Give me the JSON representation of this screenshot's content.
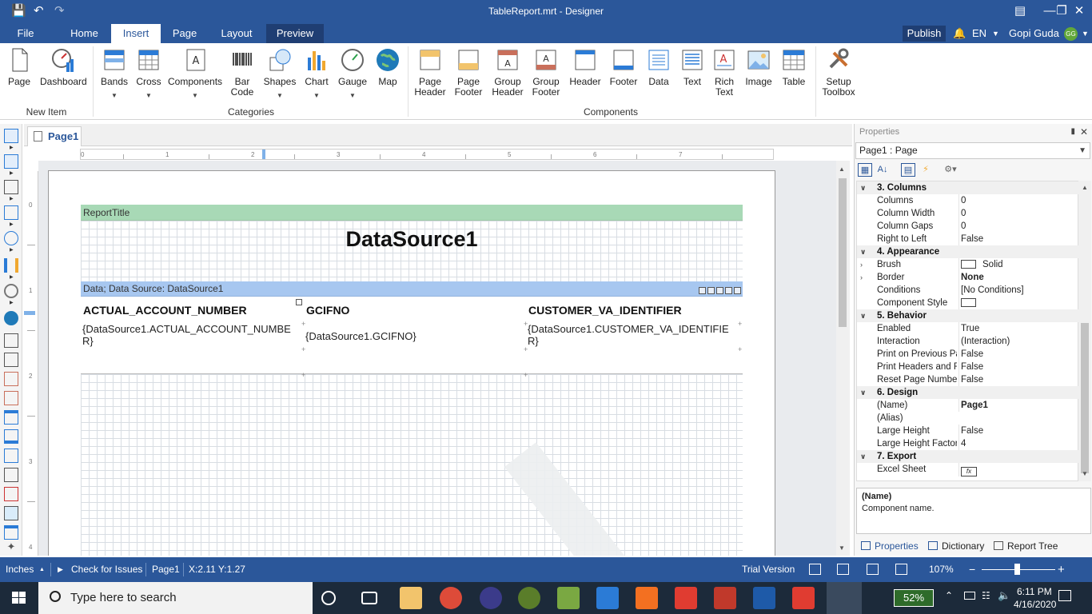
{
  "window": {
    "title": "TableReport.mrt - Designer"
  },
  "tabs": [
    {
      "label": "File"
    },
    {
      "label": "Home"
    },
    {
      "label": "Insert"
    },
    {
      "label": "Page"
    },
    {
      "label": "Layout"
    },
    {
      "label": "Preview"
    }
  ],
  "account": {
    "publish": "Publish",
    "language": "EN",
    "user": "Gopi Guda",
    "initials": "GG"
  },
  "ribbon": {
    "new_item": {
      "group": "New Item",
      "page": "Page",
      "dashboard": "Dashboard"
    },
    "categories": {
      "group": "Categories",
      "bands": "Bands",
      "cross": "Cross",
      "components": "Components",
      "barcode": "Bar Code",
      "shapes": "Shapes",
      "chart": "Chart",
      "gauge": "Gauge",
      "map": "Map"
    },
    "components": {
      "group": "Components",
      "page_header": "Page Header",
      "page_footer": "Page Footer",
      "group_header": "Group Header",
      "group_footer": "Group Footer",
      "header": "Header",
      "footer": "Footer",
      "data": "Data",
      "text": "Text",
      "rich_text": "Rich Text",
      "image": "Image",
      "table": "Table"
    },
    "setup_toolbox": "Setup Toolbox"
  },
  "document": {
    "tab": "Page1",
    "ruler_h": [
      "0",
      "1",
      "2",
      "3",
      "4",
      "5",
      "6",
      "7"
    ],
    "ruler_v": [
      "0",
      "1",
      "2",
      "3",
      "4"
    ],
    "report_title_band": "ReportTitle",
    "title_text": "DataSource1",
    "data_band": "Data; Data Source: DataSource1",
    "columns": [
      {
        "header": "ACTUAL_ACCOUNT_NUMBER",
        "expr": "{DataSource1.ACTUAL_ACCOUNT_NUMBER}"
      },
      {
        "header": "GCIFNO",
        "expr": "{DataSource1.GCIFNO}"
      },
      {
        "header": "CUSTOMER_VA_IDENTIFIER",
        "expr": "{DataSource1.CUSTOMER_VA_IDENTIFIER}"
      }
    ]
  },
  "properties": {
    "header": "Properties",
    "selected": "Page1 : Page",
    "rows": [
      {
        "cat": true,
        "name": "3. Columns"
      },
      {
        "name": "Columns",
        "value": "0"
      },
      {
        "name": "Column Width",
        "value": "0"
      },
      {
        "name": "Column Gaps",
        "value": "0"
      },
      {
        "name": "Right to Left",
        "value": "False"
      },
      {
        "cat": true,
        "name": "4. Appearance"
      },
      {
        "name": "Brush",
        "value": "Solid",
        "swatch": true,
        "expandable": true
      },
      {
        "name": "Border",
        "value": "None",
        "bold": true,
        "expandable": true
      },
      {
        "name": "Conditions",
        "value": "[No Conditions]"
      },
      {
        "name": "Component Style",
        "value": "",
        "swatch": true
      },
      {
        "cat": true,
        "name": "5. Behavior"
      },
      {
        "name": "Enabled",
        "value": "True"
      },
      {
        "name": "Interaction",
        "value": "(Interaction)"
      },
      {
        "name": "Print on Previous Page",
        "value": "False"
      },
      {
        "name": "Print Headers and Footers from Previous Page",
        "value": "False"
      },
      {
        "name": "Reset Page Number",
        "value": "False"
      },
      {
        "cat": true,
        "name": "6. Design"
      },
      {
        "name": "(Name)",
        "value": "Page1",
        "bold": true
      },
      {
        "name": "(Alias)",
        "value": ""
      },
      {
        "name": "Large Height",
        "value": "False"
      },
      {
        "name": "Large Height Factor",
        "value": "4"
      },
      {
        "cat": true,
        "name": "7. Export"
      },
      {
        "name": "Excel Sheet",
        "value": "",
        "fx": true
      }
    ],
    "desc_title": "(Name)",
    "desc_text": "Component name.",
    "tabs": [
      {
        "label": "Properties"
      },
      {
        "label": "Dictionary"
      },
      {
        "label": "Report Tree"
      }
    ]
  },
  "status": {
    "units": "Inches",
    "check": "Check for Issues",
    "page": "Page1",
    "coords": "X:2.11 Y:1.27",
    "trial": "Trial Version",
    "zoom": "107%"
  },
  "taskbar": {
    "search": "Type here to search",
    "battery": "52%",
    "time": "6:11 PM",
    "date": "4/16/2020"
  }
}
